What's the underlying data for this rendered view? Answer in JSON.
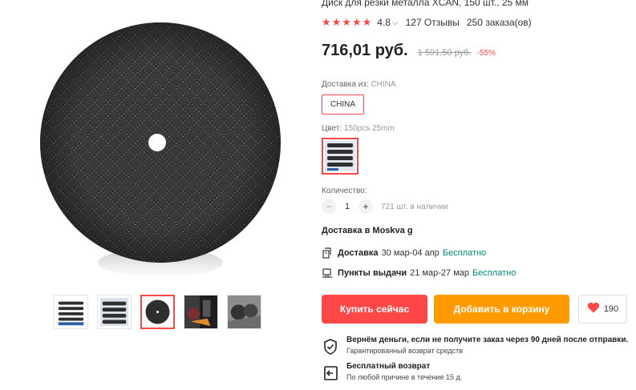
{
  "product": {
    "title": "Диск для резки металла XCAN, 150 шт., 25 мм",
    "stars": "★★★★★",
    "rating": "4.8",
    "reviews": "127 Отзывы",
    "orders": "250 заказа(ов)",
    "price": "716,01 руб.",
    "old_price": "1 591,50 руб.",
    "discount": "-55%"
  },
  "shipping_from": {
    "label": "Доставка из:",
    "value": "CHINA",
    "option": "CHINA"
  },
  "color": {
    "label": "Цвет:",
    "value": "150pcs 25mm"
  },
  "quantity": {
    "label": "Количество:",
    "minus": "−",
    "value": "1",
    "plus": "+",
    "stock": "721 шт. в наличии"
  },
  "delivery": {
    "to": "Доставка в Moskva g",
    "lines": [
      {
        "title": "Доставка",
        "dates": "30 мар-04 апр",
        "price": "Бесплатно",
        "icon": "parcel-icon"
      },
      {
        "title": "Пункты выдачи",
        "dates": "21 мар-27 мар",
        "price": "Бесплатно",
        "icon": "pickup-point-icon"
      }
    ]
  },
  "actions": {
    "buy_now": "Купить сейчас",
    "add_to_cart": "Добавить в корзину",
    "wishlist_count": "190"
  },
  "guarantees": [
    {
      "title": "Вернём деньги, если не получите заказ через 90 дней после отправки.",
      "subtitle": "Гарантированный возврат средств",
      "icon": "shield-check-icon"
    },
    {
      "title": "Бесплатный возврат",
      "subtitle": "По любой причине в течение 15 д.",
      "icon": "return-icon"
    }
  ],
  "gallery": {
    "thumbnails": [
      "thumb-1",
      "thumb-2",
      "thumb-3",
      "thumb-4",
      "thumb-5"
    ],
    "active_index": 2
  },
  "colors": {
    "accent": "#ff4747",
    "cart": "#ff9a00",
    "free_delivery": "#00897b"
  }
}
